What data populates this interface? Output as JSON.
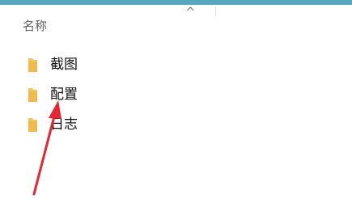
{
  "header": {
    "column_name": "名称",
    "sort_icon": "chevron-up-icon",
    "sort_glyph": "^"
  },
  "files": [
    {
      "label": "截图",
      "icon": "folder-icon"
    },
    {
      "label": "配置",
      "icon": "folder-icon"
    },
    {
      "label": "日志",
      "icon": "folder-icon"
    }
  ],
  "colors": {
    "top_bar": "#56a7bf",
    "folder": "#f4c45a",
    "annotation_arrow": "#e3262f"
  }
}
